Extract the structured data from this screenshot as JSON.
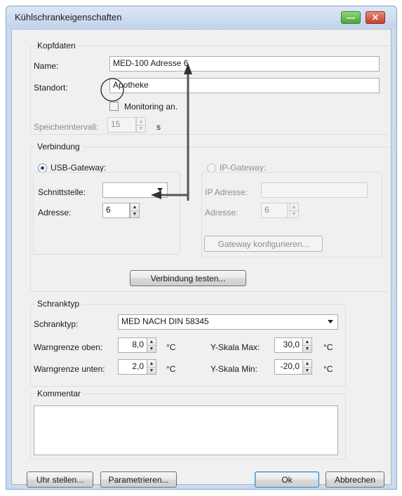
{
  "window": {
    "title": "Kühlschrankeigenschaften"
  },
  "kopfdaten": {
    "legend": "Kopfdaten",
    "name_label": "Name:",
    "name_value": "MED-100 Adresse 6",
    "standort_label": "Standort:",
    "standort_value": "Apotheke",
    "monitoring_label": "Monitoring an.",
    "speicher_label": "Speicherintervall:",
    "speicher_value": "15",
    "speicher_unit": "s"
  },
  "verbindung": {
    "legend": "Verbindung",
    "usb": {
      "label": "USB-Gateway:",
      "selected": true,
      "schnittstelle_label": "Schnittstelle:",
      "schnittstelle_value": "",
      "adresse_label": "Adresse:",
      "adresse_value": "6"
    },
    "ip": {
      "label": "IP-Gateway:",
      "selected": false,
      "ip_label": "IP Adresse:",
      "ip_value": "",
      "adresse_label": "Adresse:",
      "adresse_value": "6",
      "configure_button": "Gateway konfigurieren..."
    },
    "test_button": "Verbindung testen..."
  },
  "schranktyp": {
    "legend": "Schranktyp",
    "type_label": "Schranktyp:",
    "type_value": "MED NACH DIN 58345",
    "warn_oben_label": "Warngrenze oben:",
    "warn_oben_value": "8,0",
    "warn_unten_label": "Warngrenze unten:",
    "warn_unten_value": "2,0",
    "unit": "°C",
    "y_max_label": "Y-Skala Max:",
    "y_max_value": "30,0",
    "y_min_label": "Y-Skala Min:",
    "y_min_value": "-20,0"
  },
  "kommentar": {
    "legend": "Kommentar",
    "value": ""
  },
  "footer": {
    "uhr_button": "Uhr stellen...",
    "param_button": "Parametrieren...",
    "ok_button": "Ok",
    "cancel_button": "Abbrechen"
  },
  "colors": {
    "annotation_arrow": "#333333",
    "title_bar": "#c9d9ee"
  }
}
